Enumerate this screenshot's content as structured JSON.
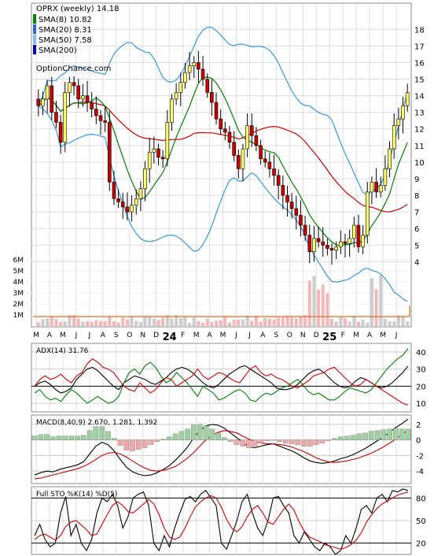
{
  "chart_data": [
    {
      "type": "candlestick",
      "title": "OPRX (weekly) 14.18",
      "watermark": "OptionChance.com",
      "x_months": [
        "M",
        "A",
        "M",
        "J",
        "J",
        "A",
        "S",
        "O",
        "N",
        "D",
        "24",
        "F",
        "M",
        "A",
        "M",
        "J",
        "J",
        "A",
        "S",
        "O",
        "N",
        "D",
        "25",
        "F",
        "M",
        "A",
        "M",
        "J"
      ],
      "y_ticks": [
        4,
        5,
        6,
        7,
        8,
        9,
        10,
        11,
        12,
        13,
        14,
        15,
        16,
        17,
        18
      ],
      "ylim": [
        3.4,
        19.2
      ],
      "legend": [
        {
          "label": "SMA(8) 10.82",
          "color": "#008000"
        },
        {
          "label": "SMA(20) 8.31",
          "color": "#3366cc"
        },
        {
          "label": "SMA(50) 7.58",
          "color": "#88bbee"
        },
        {
          "label": "SMA(200)",
          "color": "#0000aa"
        }
      ],
      "close_series": [
        13.4,
        13.8,
        14.6,
        13.0,
        12.4,
        11.2,
        14.2,
        14.8,
        14.6,
        13.8,
        14.0,
        13.6,
        13.2,
        12.8,
        12.5,
        12.4,
        8.8,
        7.8,
        7.6,
        7.3,
        7.0,
        7.4,
        7.8,
        8.4,
        9.6,
        10.6,
        10.8,
        10.3,
        10.2,
        12.4,
        13.8,
        14.2,
        14.8,
        15.4,
        15.8,
        16.0,
        15.6,
        15.0,
        14.2,
        13.6,
        12.6,
        12.0,
        11.8,
        11.2,
        10.4,
        9.6,
        10.8,
        12.2,
        11.6,
        11.0,
        10.2,
        10.0,
        9.6,
        9.2,
        8.6,
        8.0,
        7.6,
        7.2,
        6.8,
        6.2,
        5.6,
        4.6,
        5.4,
        5.2,
        5.0,
        4.8,
        4.7,
        4.9,
        5.2,
        5.1,
        5.4,
        6.2,
        4.9,
        5.6,
        8.2,
        8.8,
        8.2,
        8.6,
        9.6,
        10.8,
        12.2,
        12.6,
        13.4,
        14.18
      ],
      "volume_ticks": [
        "1M",
        "2M",
        "3M",
        "4M",
        "5M",
        "6M"
      ]
    },
    {
      "type": "line",
      "title": "ADX(14) 31.76",
      "ylim": [
        5,
        45
      ],
      "y_ticks": [
        10,
        20,
        30,
        40
      ],
      "series": [
        {
          "name": "ADX(14)",
          "color": "#000000",
          "values": [
            20,
            22,
            23,
            21,
            18,
            16,
            17,
            19,
            24,
            27,
            30,
            31,
            29,
            26,
            23,
            20,
            18,
            22,
            24,
            26,
            25,
            24,
            22,
            21,
            23,
            25,
            28,
            30,
            31,
            30,
            28,
            25,
            22,
            20,
            19,
            21,
            24,
            27,
            29,
            31,
            32,
            30,
            28,
            26,
            24,
            22,
            19,
            18,
            18,
            19,
            21,
            24,
            27,
            29,
            30,
            28,
            25,
            22,
            20,
            19,
            20,
            23,
            25,
            24,
            22,
            20,
            19,
            20,
            22,
            25,
            28,
            31.76
          ]
        },
        {
          "name": "+DI",
          "color": "#008000",
          "values": [
            16,
            18,
            14,
            12,
            13,
            11,
            15,
            18,
            16,
            13,
            10,
            12,
            14,
            12,
            10,
            11,
            14,
            22,
            28,
            30,
            27,
            32,
            34,
            31,
            26,
            22,
            24,
            28,
            25,
            22,
            18,
            14,
            20,
            18,
            16,
            12,
            13,
            15,
            17,
            18,
            16,
            12,
            11,
            14,
            16,
            15,
            17,
            19,
            20,
            22,
            24,
            21,
            17,
            15,
            16,
            14,
            12,
            12,
            14,
            17,
            19,
            18,
            17,
            16,
            18,
            22,
            26,
            30,
            33,
            36,
            38,
            42
          ]
        },
        {
          "name": "-DI",
          "color": "#cc0000",
          "values": [
            20,
            24,
            26,
            24,
            25,
            27,
            24,
            22,
            26,
            28,
            33,
            36,
            34,
            31,
            30,
            28,
            24,
            20,
            18,
            17,
            22,
            19,
            16,
            18,
            22,
            25,
            24,
            20,
            22,
            24,
            26,
            30,
            26,
            24,
            26,
            28,
            27,
            25,
            23,
            22,
            26,
            30,
            32,
            28,
            26,
            27,
            25,
            24,
            22,
            20,
            19,
            21,
            23,
            26,
            27,
            28,
            30,
            31,
            28,
            25,
            22,
            20,
            21,
            24,
            22,
            20,
            18,
            16,
            14,
            12,
            10,
            9
          ]
        }
      ]
    },
    {
      "type": "line",
      "title": "MACD(8,40,9) 2.670, 1.281, 1.392",
      "ylim": [
        -5.6,
        3.2
      ],
      "y_ticks": [
        -4,
        -2,
        0,
        2
      ],
      "series": [
        {
          "name": "MACD",
          "color": "#000000",
          "values": [
            -4.5,
            -4.2,
            -4.0,
            -4.1,
            -3.8,
            -3.6,
            -3.4,
            -3.2,
            -2.8,
            -1.8,
            -0.8,
            -0.3,
            -0.6,
            -1.4,
            -2.5,
            -3.5,
            -4.1,
            -4.4,
            -4.6,
            -4.5,
            -4.2,
            -3.8,
            -3.3,
            -2.6,
            -1.8,
            -0.9,
            0.3,
            1.2,
            1.8,
            2.0,
            1.9,
            1.5,
            0.9,
            0.3,
            -0.3,
            -0.9,
            -1.0,
            -0.8,
            -0.6,
            -0.5,
            -0.8,
            -1.1,
            -1.4,
            -1.8,
            -2.3,
            -2.7,
            -2.9,
            -3.0,
            -2.9,
            -2.7,
            -2.4,
            -2.2,
            -1.9,
            -1.5,
            -1.1,
            -0.6,
            -0.1,
            0.4,
            1.0,
            1.6,
            2.1,
            2.67
          ]
        },
        {
          "name": "Signal",
          "color": "#cc0000",
          "values": [
            -5.0,
            -4.9,
            -4.7,
            -4.5,
            -4.3,
            -4.1,
            -3.9,
            -3.7,
            -3.4,
            -3.0,
            -2.5,
            -2.0,
            -1.7,
            -1.6,
            -1.8,
            -2.2,
            -2.7,
            -3.2,
            -3.6,
            -3.9,
            -4.0,
            -3.9,
            -3.7,
            -3.4,
            -2.9,
            -2.3,
            -1.6,
            -0.8,
            0.0,
            0.6,
            1.0,
            1.2,
            1.1,
            0.9,
            0.5,
            0.1,
            -0.2,
            -0.4,
            -0.5,
            -0.5,
            -0.6,
            -0.7,
            -0.9,
            -1.2,
            -1.5,
            -1.9,
            -2.3,
            -2.6,
            -2.8,
            -2.9,
            -2.8,
            -2.7,
            -2.5,
            -2.3,
            -2.0,
            -1.7,
            -1.3,
            -0.9,
            -0.4,
            0.1,
            0.7,
            1.281
          ]
        },
        {
          "name": "Histogram",
          "type": "bar",
          "values": [
            0.5,
            0.7,
            0.7,
            0.4,
            0.5,
            0.5,
            0.5,
            0.5,
            0.6,
            1.2,
            1.7,
            1.7,
            1.1,
            0.2,
            -0.7,
            -1.3,
            -1.4,
            -1.2,
            -1.0,
            -0.6,
            -0.2,
            0.1,
            0.4,
            0.8,
            1.1,
            1.4,
            1.9,
            2.0,
            1.8,
            1.4,
            0.9,
            0.3,
            -0.2,
            -0.6,
            -0.8,
            -1.0,
            -0.8,
            -0.4,
            -0.1,
            0.0,
            -0.2,
            -0.4,
            -0.5,
            -0.6,
            -0.8,
            -0.8,
            -0.6,
            -0.4,
            -0.1,
            0.2,
            0.4,
            0.5,
            0.6,
            0.8,
            0.9,
            1.1,
            1.2,
            1.3,
            1.4,
            1.5,
            1.4,
            1.392
          ]
        }
      ]
    },
    {
      "type": "line",
      "title": "Full STO %K(14) %D(5)",
      "ylim": [
        5,
        95
      ],
      "y_ticks": [
        20,
        50,
        80
      ],
      "series": [
        {
          "name": "%K(14)",
          "color": "#000000",
          "values": [
            30,
            45,
            25,
            15,
            20,
            60,
            82,
            30,
            45,
            20,
            10,
            25,
            60,
            80,
            75,
            85,
            70,
            40,
            55,
            80,
            85,
            88,
            70,
            20,
            10,
            30,
            15,
            40,
            60,
            78,
            82,
            75,
            85,
            90,
            80,
            70,
            20,
            12,
            30,
            50,
            75,
            85,
            60,
            40,
            30,
            50,
            80,
            82,
            70,
            60,
            30,
            20,
            35,
            25,
            15,
            10,
            20,
            15,
            5,
            10,
            30,
            20,
            40,
            65,
            70,
            60,
            80,
            85,
            75,
            90,
            88,
            92,
            90
          ]
        },
        {
          "name": "%D(5)",
          "color": "#cc0000",
          "values": [
            25,
            30,
            32,
            28,
            24,
            30,
            42,
            48,
            50,
            44,
            38,
            30,
            32,
            45,
            58,
            70,
            75,
            70,
            62,
            60,
            66,
            72,
            78,
            72,
            58,
            40,
            28,
            25,
            28,
            40,
            55,
            68,
            75,
            80,
            83,
            80,
            68,
            52,
            40,
            35,
            42,
            55,
            65,
            70,
            60,
            48,
            45,
            55,
            65,
            72,
            64,
            48,
            36,
            28,
            25,
            22,
            18,
            16,
            14,
            12,
            14,
            18,
            24,
            34,
            48,
            58,
            66,
            72,
            76,
            80,
            84,
            86,
            88
          ]
        }
      ]
    }
  ]
}
